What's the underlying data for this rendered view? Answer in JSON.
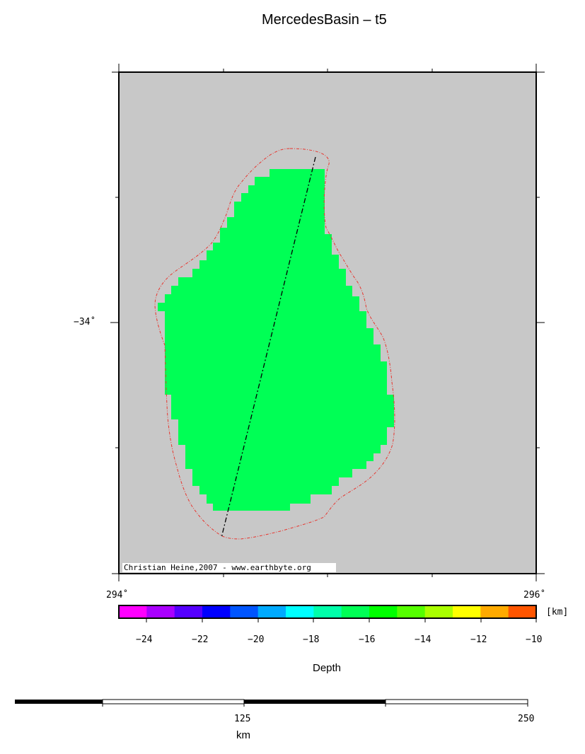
{
  "map": {
    "title": "MercedesBasin – t5",
    "lat_label": "−34˚",
    "lon_labels": [
      "294˚",
      "296˚"
    ],
    "credit": "Christian Heine,2007 - www.earthbyte.org",
    "background_color": "#c8c8c8",
    "basin_fill_color": "#00ff55",
    "outline_color": "#e8352e",
    "profile_line_color": "#000000"
  },
  "colorbar": {
    "unit": "[km]",
    "label": "Depth",
    "ticks": [
      "−24",
      "−22",
      "−20",
      "−18",
      "−16",
      "−14",
      "−12",
      "−10"
    ],
    "colors": [
      "#ff00ff",
      "#aa00ff",
      "#5500ff",
      "#0000ff",
      "#0055ff",
      "#00aaff",
      "#00ffff",
      "#00ffaa",
      "#00ff55",
      "#00ff00",
      "#55ff00",
      "#aaff00",
      "#ffff00",
      "#ffaa00",
      "#ff5500"
    ]
  },
  "scalebar": {
    "labels": [
      "125",
      "250"
    ],
    "unit": "km"
  }
}
